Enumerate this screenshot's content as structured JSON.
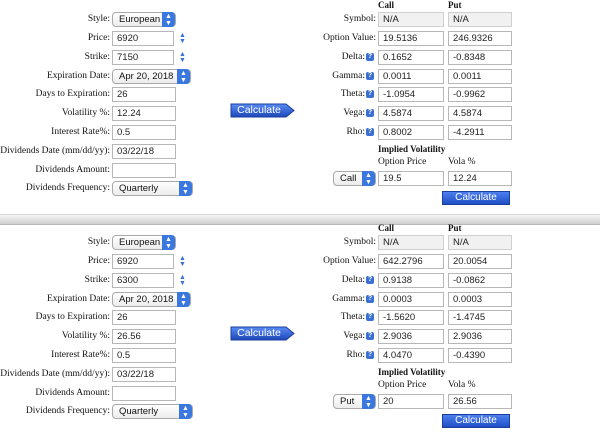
{
  "labels": {
    "style": "Style:",
    "price": "Price:",
    "strike": "Strike:",
    "expiration_date": "Expiration Date:",
    "days_to_expiration": "Days to Expiration:",
    "volatility": "Volatility %:",
    "interest_rate": "Interest Rate%:",
    "dividends_date": "Dividends Date (mm/dd/yy):",
    "dividends_amount": "Dividends Amount:",
    "dividends_frequency": "Dividends Frequency:",
    "call_header": "Call",
    "put_header": "Put",
    "symbol": "Symbol:",
    "option_value": "Option Value:",
    "delta": "Delta:",
    "gamma": "Gamma:",
    "theta": "Theta:",
    "vega": "Vega:",
    "rho": "Rho:",
    "implied_volatility": "Implied Volatility",
    "option_price": "Option Price",
    "vola_pct": "Vola %",
    "calculate": "Calculate",
    "help_glyph": "?"
  },
  "colors": {
    "accent_blue": "#3a6fd4",
    "button_blue": "#1f4fc4"
  },
  "panels": [
    {
      "inputs": {
        "style": "European",
        "price": "6920",
        "strike": "7150",
        "expiration_date": "Apr 20, 2018",
        "days_to_expiration": "26",
        "volatility": "12.24",
        "interest_rate": "0.5",
        "dividends_date": "03/22/18",
        "dividends_amount": "",
        "dividends_frequency": "Quarterly"
      },
      "results": {
        "symbol": {
          "call": "N/A",
          "put": "N/A"
        },
        "option_value": {
          "call": "19.5136",
          "put": "246.9326"
        },
        "delta": {
          "call": "0.1652",
          "put": "-0.8348"
        },
        "gamma": {
          "call": "0.0011",
          "put": "0.0011"
        },
        "theta": {
          "call": "-1.0954",
          "put": "-0.9962"
        },
        "vega": {
          "call": "4.5874",
          "put": "4.5874"
        },
        "rho": {
          "call": "0.8002",
          "put": "-4.2911"
        }
      },
      "implied": {
        "type": "Call",
        "option_price": "19.5",
        "vola": "12.24"
      }
    },
    {
      "inputs": {
        "style": "European",
        "price": "6920",
        "strike": "6300",
        "expiration_date": "Apr 20, 2018",
        "days_to_expiration": "26",
        "volatility": "26.56",
        "interest_rate": "0.5",
        "dividends_date": "03/22/18",
        "dividends_amount": "",
        "dividends_frequency": "Quarterly"
      },
      "results": {
        "symbol": {
          "call": "N/A",
          "put": "N/A"
        },
        "option_value": {
          "call": "642.2796",
          "put": "20.0054"
        },
        "delta": {
          "call": "0.9138",
          "put": "-0.0862"
        },
        "gamma": {
          "call": "0.0003",
          "put": "0.0003"
        },
        "theta": {
          "call": "-1.5620",
          "put": "-1.4745"
        },
        "vega": {
          "call": "2.9036",
          "put": "2.9036"
        },
        "rho": {
          "call": "4.0470",
          "put": "-0.4390"
        }
      },
      "implied": {
        "type": "Put",
        "option_price": "20",
        "vola": "26.56"
      }
    }
  ]
}
